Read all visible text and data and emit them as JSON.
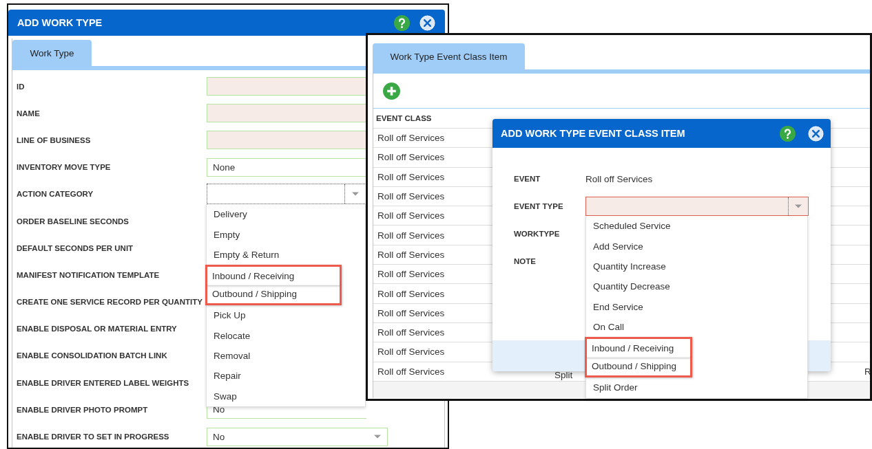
{
  "work_type_dialog": {
    "title": "ADD WORK TYPE",
    "tabs": [
      {
        "label": "Work Type",
        "selected": true
      }
    ],
    "fields": [
      {
        "label": "ID",
        "kind": "required"
      },
      {
        "label": "NAME",
        "kind": "required"
      },
      {
        "label": "LINE OF BUSINESS",
        "kind": "required"
      },
      {
        "label": "INVENTORY MOVE TYPE",
        "kind": "select",
        "value": "None"
      },
      {
        "label": "ACTION CATEGORY",
        "kind": "open-select",
        "options": [
          {
            "label": "Delivery",
            "highlighted": false
          },
          {
            "label": "Empty",
            "highlighted": false
          },
          {
            "label": "Empty & Return",
            "highlighted": false
          },
          {
            "label": "Inbound / Receiving",
            "highlighted": true
          },
          {
            "label": "Outbound / Shipping",
            "highlighted": true
          },
          {
            "label": "Pick Up",
            "highlighted": false
          },
          {
            "label": "Relocate",
            "highlighted": false
          },
          {
            "label": "Removal",
            "highlighted": false
          },
          {
            "label": "Repair",
            "highlighted": false
          },
          {
            "label": "Swap",
            "highlighted": false
          }
        ]
      },
      {
        "label": "ORDER BASELINE SECONDS",
        "kind": "covered"
      },
      {
        "label": "DEFAULT SECONDS PER UNIT",
        "kind": "covered"
      },
      {
        "label": "MANIFEST NOTIFICATION TEMPLATE",
        "kind": "covered"
      },
      {
        "label": "CREATE ONE SERVICE RECORD PER QUANTITY",
        "kind": "covered"
      },
      {
        "label": "ENABLE DISPOSAL OR MATERIAL ENTRY",
        "kind": "covered"
      },
      {
        "label": "ENABLE CONSOLIDATION BATCH LINK",
        "kind": "covered"
      },
      {
        "label": "ENABLE DRIVER ENTERED LABEL WEIGHTS",
        "kind": "covered"
      },
      {
        "label": "ENABLE DRIVER PHOTO PROMPT",
        "kind": "select",
        "value": "No"
      },
      {
        "label": "ENABLE DRIVER TO SET IN PROGRESS",
        "kind": "select",
        "value": "No"
      }
    ]
  },
  "event_class_window": {
    "tabs": [
      {
        "label": "Work Type Event Class Item",
        "selected": true
      }
    ],
    "table": {
      "columns": [
        "EVENT CLASS"
      ],
      "rows": [
        {
          "event_class": "Roll off Services"
        },
        {
          "event_class": "Roll off Services"
        },
        {
          "event_class": "Roll off Services"
        },
        {
          "event_class": "Roll off Services"
        },
        {
          "event_class": "Roll off Services"
        },
        {
          "event_class": "Roll off Services"
        },
        {
          "event_class": "Roll off Services"
        },
        {
          "event_class": "Roll off Services"
        },
        {
          "event_class": "Roll off Services"
        },
        {
          "event_class": "Roll off Services"
        },
        {
          "event_class": "Roll off Services"
        },
        {
          "event_class": "Roll off Services"
        },
        {
          "event_class": "Roll off Services",
          "event_type": "Split",
          "column_3": "R"
        }
      ]
    }
  },
  "event_class_item_dialog": {
    "title": "ADD WORK TYPE EVENT CLASS ITEM",
    "fields": [
      {
        "label": "EVENT",
        "kind": "text",
        "value": "Roll off Services"
      },
      {
        "label": "EVENT TYPE",
        "kind": "open-select",
        "options": [
          {
            "label": "Scheduled Service",
            "highlighted": false
          },
          {
            "label": "Add Service",
            "highlighted": false
          },
          {
            "label": "Quantity Increase",
            "highlighted": false
          },
          {
            "label": "Quantity Decrease",
            "highlighted": false
          },
          {
            "label": "End Service",
            "highlighted": false
          },
          {
            "label": "On Call",
            "highlighted": false
          },
          {
            "label": "Inbound / Receiving",
            "highlighted": true
          },
          {
            "label": "Outbound / Shipping",
            "highlighted": true
          },
          {
            "label": "Split Order",
            "highlighted": false
          }
        ]
      },
      {
        "label": "WORKTYPE",
        "kind": "covered"
      },
      {
        "label": "NOTE",
        "kind": "covered"
      }
    ]
  }
}
